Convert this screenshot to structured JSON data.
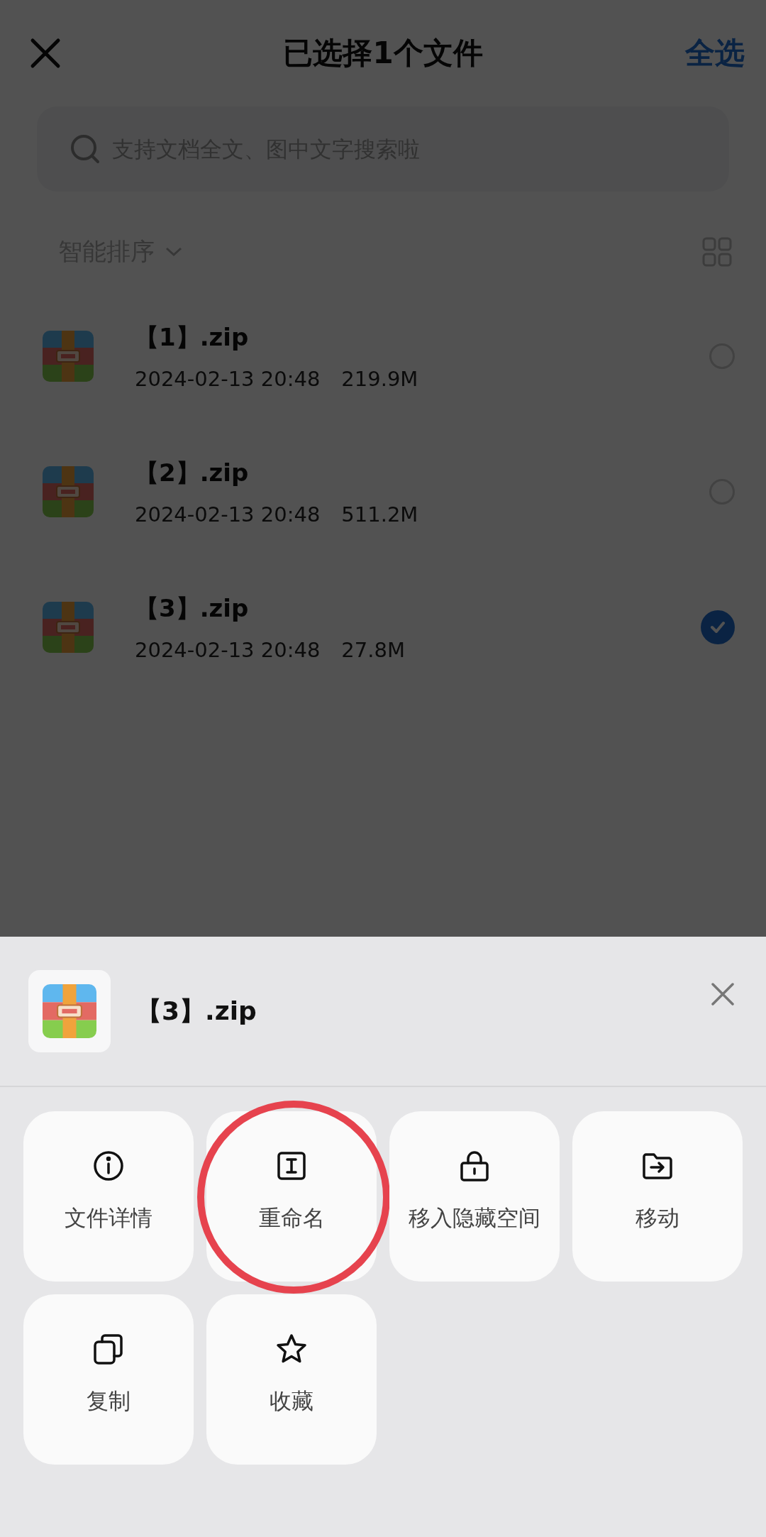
{
  "header": {
    "title": "已选择1个文件",
    "select_all": "全选"
  },
  "search": {
    "placeholder": "支持文档全文、图中文字搜索啦"
  },
  "sort": {
    "label": "智能排序"
  },
  "files": [
    {
      "name": "【1】.zip",
      "date": "2024-02-13 20:48",
      "size": "219.9M",
      "selected": false
    },
    {
      "name": "【2】.zip",
      "date": "2024-02-13 20:48",
      "size": "511.2M",
      "selected": false
    },
    {
      "name": "【3】.zip",
      "date": "2024-02-13 20:48",
      "size": "27.8M",
      "selected": true
    }
  ],
  "sheet": {
    "file_name": "【3】.zip",
    "actions": [
      {
        "kind": "info",
        "label": "文件详情",
        "highlighted": false
      },
      {
        "kind": "rename",
        "label": "重命名",
        "highlighted": true
      },
      {
        "kind": "lock",
        "label": "移入隐藏空间",
        "highlighted": false
      },
      {
        "kind": "move",
        "label": "移动",
        "highlighted": false
      },
      {
        "kind": "copy",
        "label": "复制",
        "highlighted": false
      },
      {
        "kind": "star",
        "label": "收藏",
        "highlighted": false
      }
    ]
  }
}
